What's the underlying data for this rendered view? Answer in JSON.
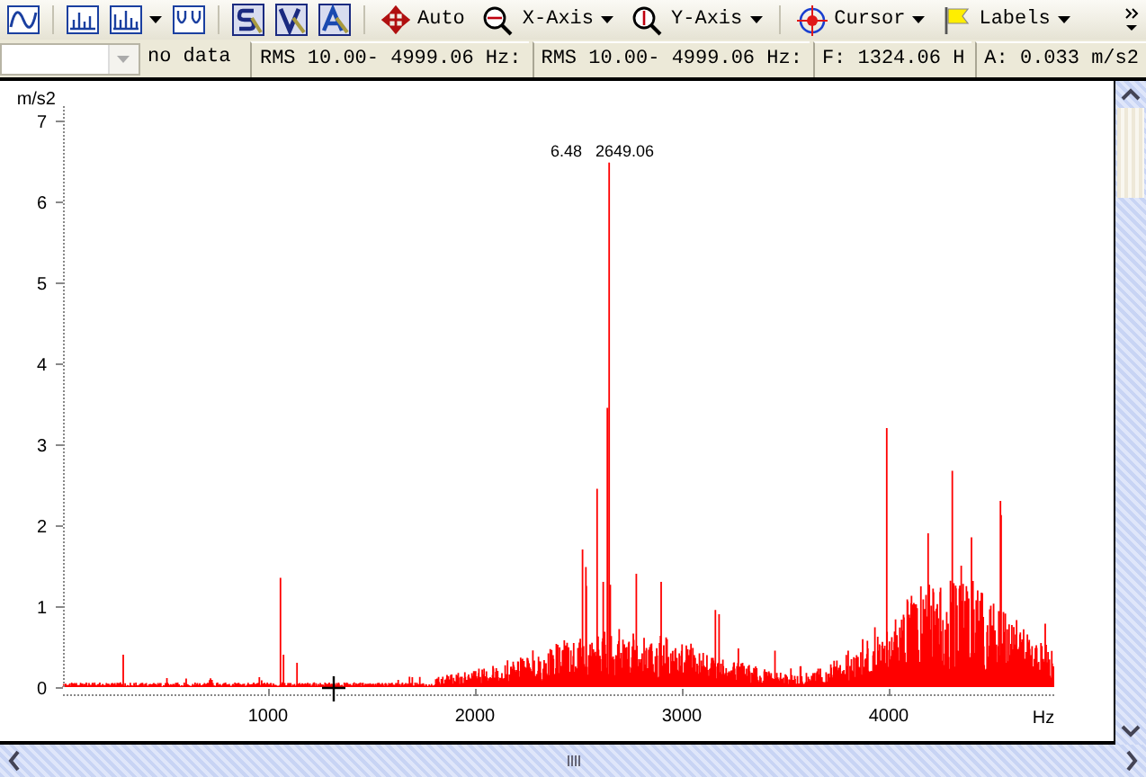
{
  "toolbar": {
    "buttons": [
      {
        "label": "Auto",
        "menu": false
      },
      {
        "label": "X-Axis",
        "menu": true
      },
      {
        "label": "Y-Axis",
        "menu": true
      },
      {
        "label": "Cursor",
        "menu": true
      },
      {
        "label": "Labels",
        "menu": true
      }
    ]
  },
  "status_bar": {
    "fields": [
      "no data",
      "RMS 10.00- 4999.06 Hz:",
      "RMS 10.00- 4999.06 Hz:",
      "F: 1324.06 H",
      "A: 0.033 m/s2"
    ]
  },
  "plot": {
    "y_unit": "m/s2",
    "x_unit": "Hz",
    "y_ticks": [
      "7",
      "6",
      "5",
      "4",
      "3",
      "2",
      "1",
      "0"
    ],
    "x_ticks": [
      "1000",
      "2000",
      "3000",
      "4000"
    ],
    "peak_label": "6.48   2649.06"
  }
}
